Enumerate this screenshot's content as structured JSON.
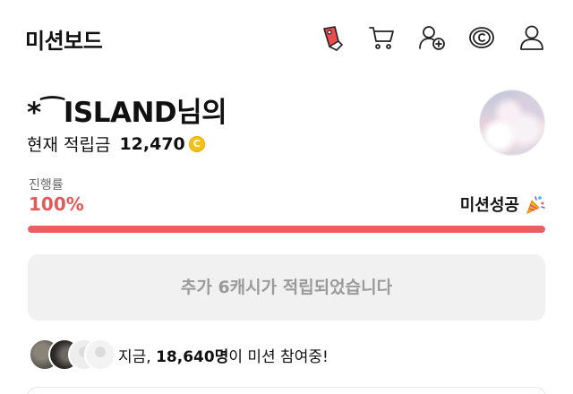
{
  "header": {
    "title": "미션보드",
    "icons": [
      "mission-tag-icon",
      "cart-icon",
      "add-user-icon",
      "cash-icon",
      "profile-icon"
    ]
  },
  "user": {
    "name": "*⁀ISLAND님의",
    "points_label": "현재 적립금",
    "points_value": "12,470",
    "coin_symbol": "C"
  },
  "progress": {
    "label": "진행률",
    "value_text": "100%",
    "fraction": 1.0,
    "status": "미션성공",
    "accent_color": "#ee5d60"
  },
  "reward_button": {
    "label": "추가 6캐시가 적립되었습니다"
  },
  "participants": {
    "prefix": "지금, ",
    "count": "18,640명",
    "suffix": "이 미션 참여중!"
  }
}
